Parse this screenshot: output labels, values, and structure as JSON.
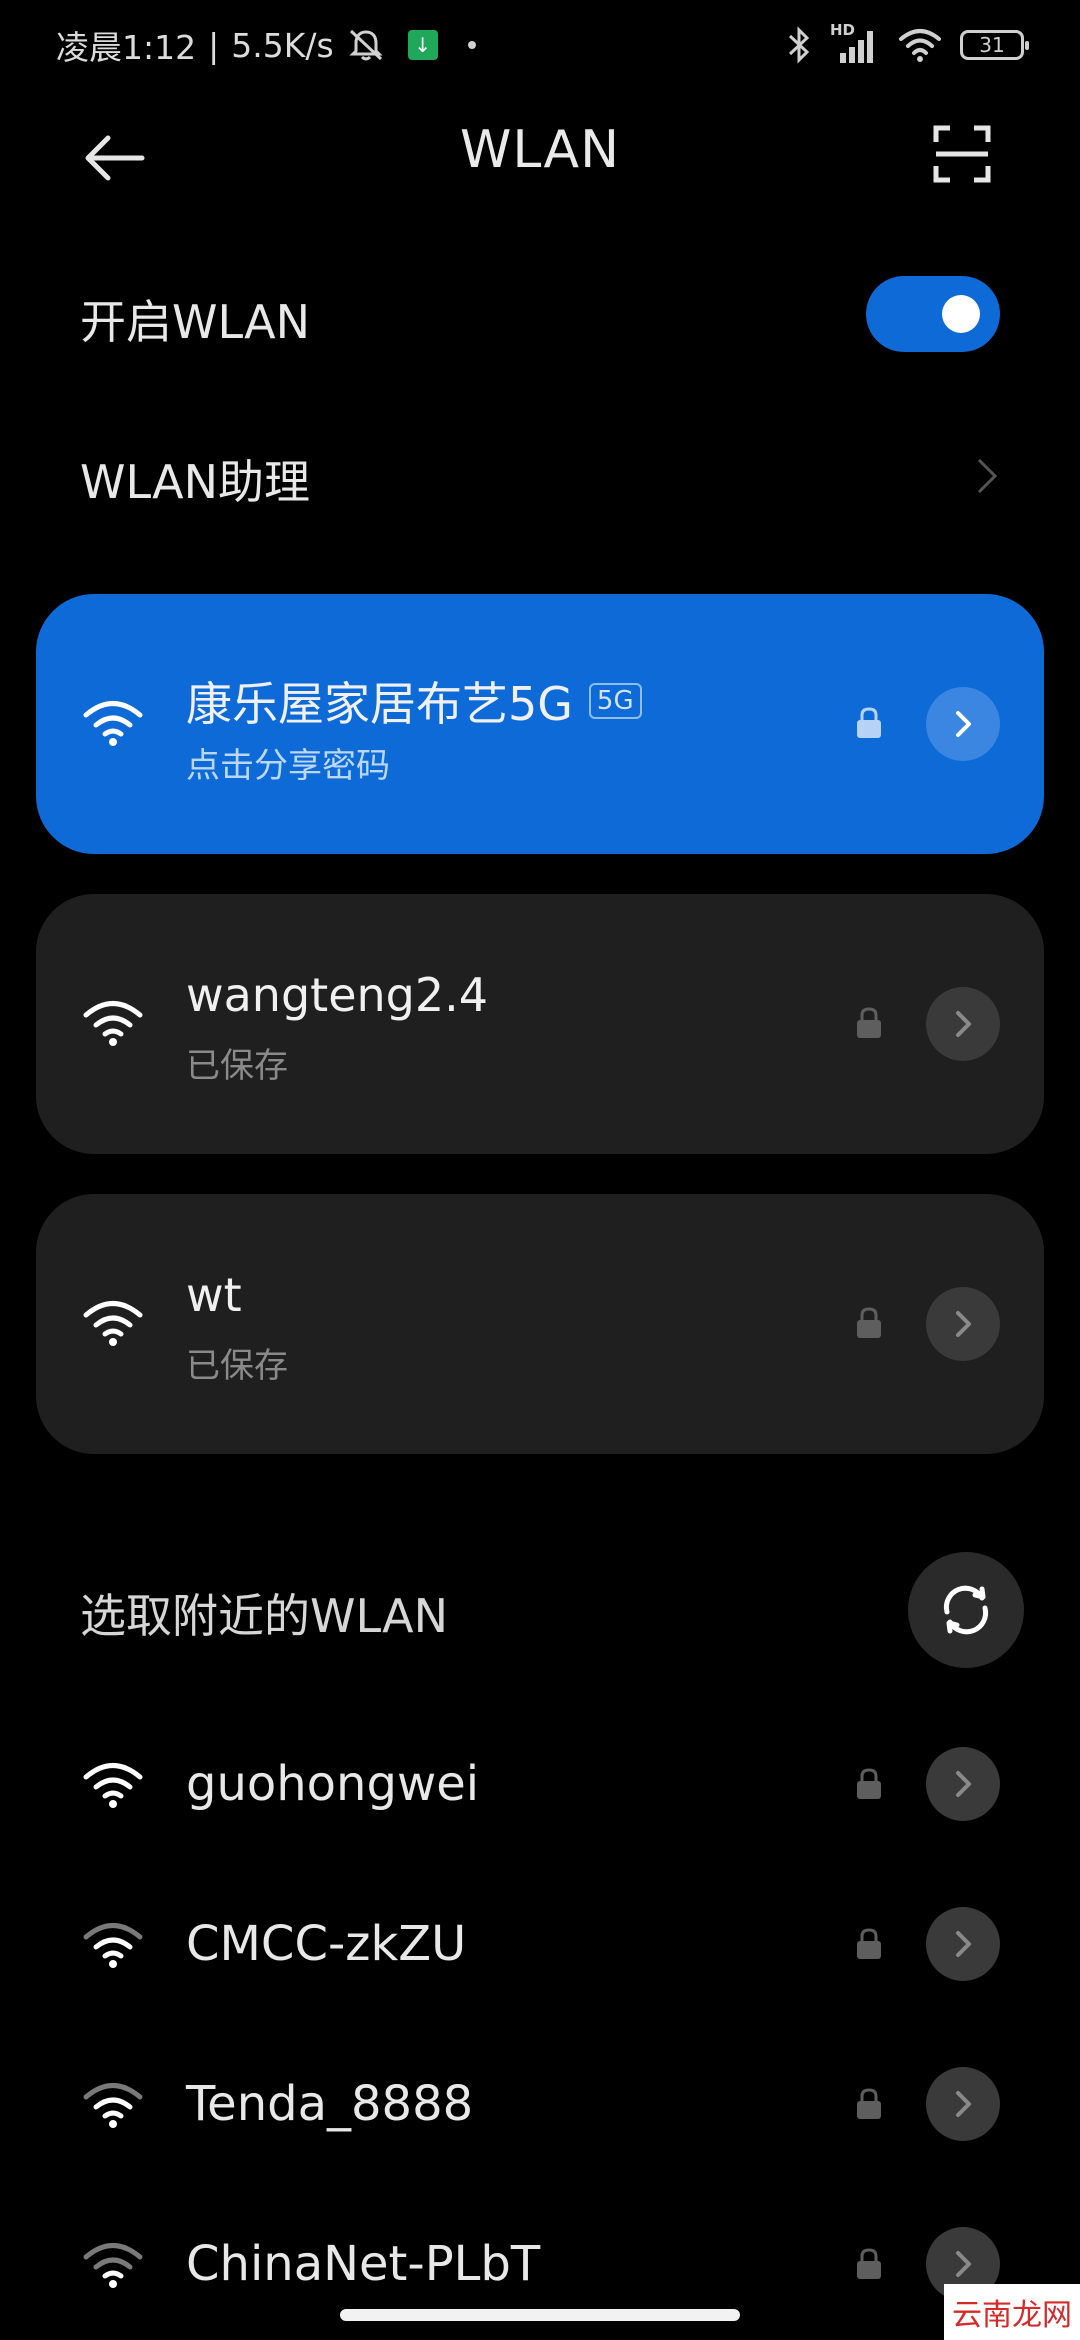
{
  "status_bar": {
    "time": "凌晨1:12",
    "separator": "|",
    "net_speed": "5.5K/s",
    "signal_label": "HD",
    "battery_level": "31",
    "icons": [
      "mute-icon",
      "download-icon",
      "dot-icon",
      "bluetooth-icon",
      "signal-icon",
      "wifi-status-icon",
      "battery-icon"
    ]
  },
  "header": {
    "title": "WLAN",
    "back_icon": "back-arrow-icon",
    "scan_icon": "scan-icon"
  },
  "wlan_toggle": {
    "label": "开启WLAN",
    "on": true
  },
  "assistant": {
    "label": "WLAN助理"
  },
  "saved_networks": [
    {
      "ssid": "康乐屋家居布艺5G",
      "badge": "5G",
      "subtitle": "点击分享密码",
      "connected": true,
      "secured": true
    },
    {
      "ssid": "wangteng2.4",
      "badge": "",
      "subtitle": "已保存",
      "connected": false,
      "secured": true
    },
    {
      "ssid": "wt",
      "badge": "",
      "subtitle": "已保存",
      "connected": false,
      "secured": true
    }
  ],
  "nearby": {
    "title": "选取附近的WLAN",
    "refresh_icon": "refresh-icon",
    "networks": [
      {
        "ssid": "guohongwei",
        "secured": true
      },
      {
        "ssid": "CMCC-zkZU",
        "secured": true
      },
      {
        "ssid": "Tenda_8888",
        "secured": true
      },
      {
        "ssid": "ChinaNet-PLbT",
        "secured": true
      }
    ]
  },
  "watermark": "云南龙网",
  "colors": {
    "background": "#000000",
    "accent": "#0d6ad6",
    "card": "#1f1f1f",
    "text": "#e8e8e8",
    "subtext": "#8a8a8a"
  }
}
